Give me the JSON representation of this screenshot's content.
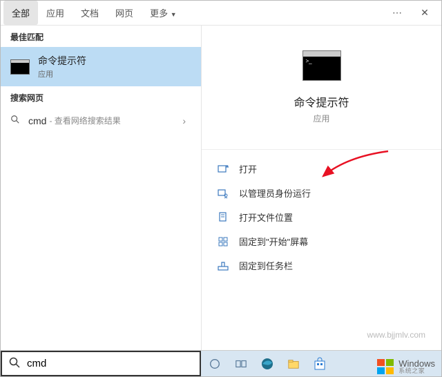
{
  "tabs": {
    "all": "全部",
    "apps": "应用",
    "docs": "文档",
    "web": "网页",
    "more": "更多"
  },
  "left": {
    "best_match_header": "最佳匹配",
    "best_match_title": "命令提示符",
    "best_match_sub": "应用",
    "search_web_header": "搜索网页",
    "web_query": "cmd",
    "web_suffix": " - 查看网络搜索结果"
  },
  "right": {
    "title": "命令提示符",
    "sub": "应用",
    "actions": {
      "open": "打开",
      "run_admin": "以管理员身份运行",
      "open_location": "打开文件位置",
      "pin_start": "固定到\"开始\"屏幕",
      "pin_taskbar": "固定到任务栏"
    }
  },
  "search": {
    "value": "cmd"
  },
  "watermark": {
    "url": "www.bjjmlv.com",
    "brand": "Windows",
    "sub": "系统之家"
  }
}
